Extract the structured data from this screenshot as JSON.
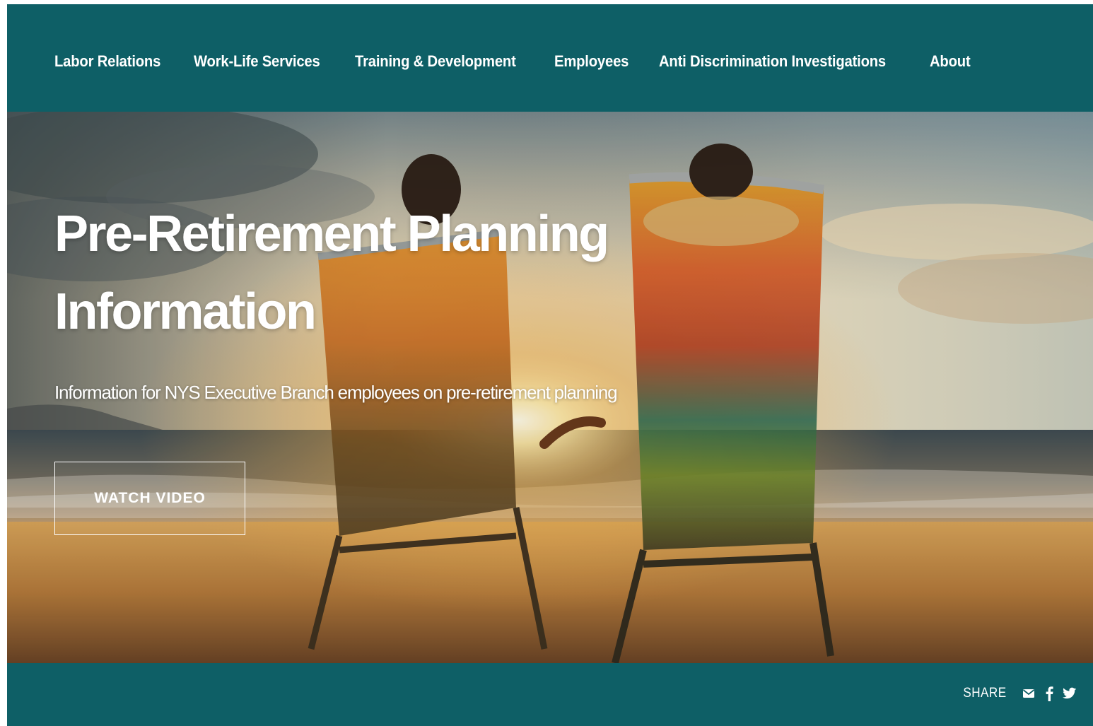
{
  "nav": {
    "items": [
      {
        "label": "Labor Relations"
      },
      {
        "label": "Work-Life Services"
      },
      {
        "label": "Training & Development"
      },
      {
        "label": "Employees"
      },
      {
        "label": "Anti Discrimination Investigations"
      },
      {
        "label": "About"
      }
    ]
  },
  "hero": {
    "title_line1": "Pre-Retirement Planning",
    "title_line2": "Information",
    "subtitle": "Information for NYS Executive Branch employees on pre-retirement planning",
    "cta_label": "WATCH VIDEO"
  },
  "footer": {
    "share_label": "SHARE",
    "share_icons": [
      "envelope-icon",
      "facebook-icon",
      "twitter-icon"
    ]
  },
  "colors": {
    "brand_teal": "#0e5f66",
    "text_on_brand": "#ffffff"
  }
}
